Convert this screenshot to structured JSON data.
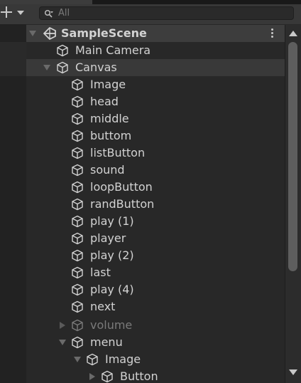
{
  "search": {
    "placeholder": "All"
  },
  "scene": {
    "name": "SampleScene"
  },
  "hierarchy": {
    "main_camera": "Main Camera",
    "canvas": "Canvas",
    "canvas_children": [
      "Image",
      "head",
      "middle",
      "buttom",
      "listButton",
      "sound",
      "loopButton",
      "randButton",
      "play (1)",
      "player",
      "play (2)",
      "last",
      "play (4)",
      "next"
    ],
    "volume": "volume",
    "menu": "menu",
    "menu_image": "Image",
    "menu_button": "Button"
  },
  "icons": {
    "add": "plus-icon",
    "add_dropdown": "chevron-down-icon",
    "search": "search-icon",
    "scene": "unity-scene-icon",
    "gameobject": "cube-icon",
    "expanded": "triangle-down-icon",
    "collapsed": "triangle-right-icon",
    "menu": "kebab-menu-icon"
  },
  "colors": {
    "background": "#282828",
    "toolbar": "#383838",
    "text": "#d2d2d2",
    "inactive_text": "#7a7a7a",
    "scene_row": "#3d3d3d"
  }
}
